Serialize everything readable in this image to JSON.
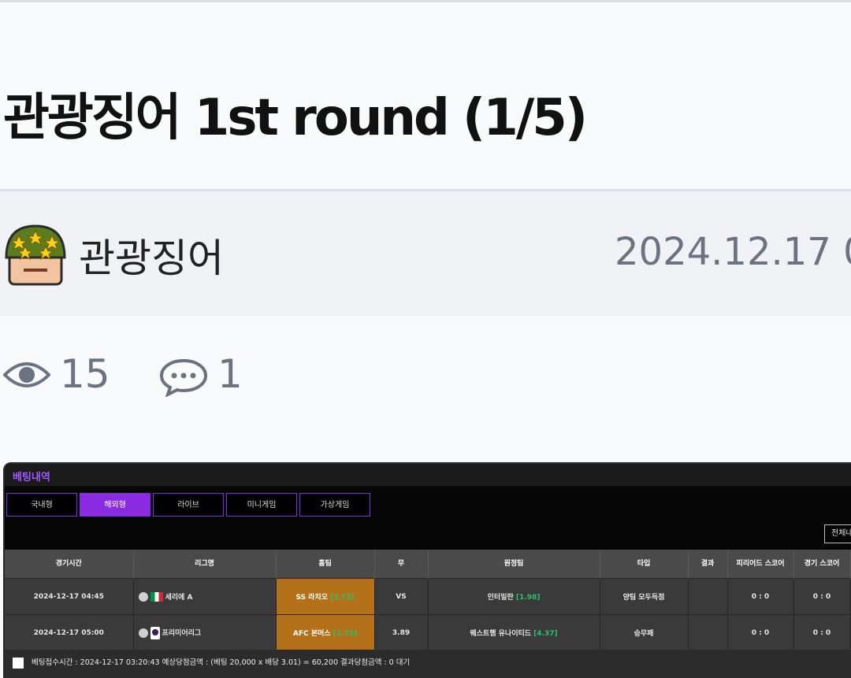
{
  "post": {
    "title": "관광징어 1st round (1/5)",
    "author": "관광징어",
    "date": "2024.12.17 0",
    "views": "15",
    "comments": "1"
  },
  "icons": {
    "views": "eye-icon",
    "comments": "speech-bubble-icon",
    "avatar": "soldier-helmet-avatar"
  },
  "colors": {
    "accent_purple": "#8a2be2",
    "home_highlight": "#b5701a",
    "odds_green": "#27c36f"
  },
  "betting": {
    "title": "베팅내역",
    "tabs": [
      "국내형",
      "해외형",
      "라이브",
      "미니게임",
      "가상게임"
    ],
    "active_tab": "해외형",
    "filter_label": "전체내",
    "columns": [
      "경기시간",
      "리그명",
      "홈팀",
      "무",
      "원정팀",
      "타입",
      "결과",
      "피리어드 스코어",
      "경기 스코어"
    ],
    "rows": [
      {
        "time": "2024-12-17 04:45",
        "league": "세리에 A",
        "home": "SS 라치오",
        "home_odds": "[1.72]",
        "draw": "VS",
        "away": "인터밀란",
        "away_odds": "[1.98]",
        "type": "양팀 모두득점",
        "result": "",
        "period_score": "0 : 0",
        "game_score": "0 : 0"
      },
      {
        "time": "2024-12-17 05:00",
        "league": "프리미어리그",
        "home": "AFC 본머스",
        "home_odds": "[1.75]",
        "draw": "3.89",
        "away": "웨스트햄 유나이티드",
        "away_odds": "[4.37]",
        "type": "승무패",
        "result": "",
        "period_score": "0 : 0",
        "game_score": "0 : 0"
      }
    ],
    "footer": "베팅접수시간 : 2024-12-17 03:20:43   예상당첨금액 : (베팅 20,000 x 배당 3.01) = 60,200   결과당첨금액 : 0   대기"
  }
}
